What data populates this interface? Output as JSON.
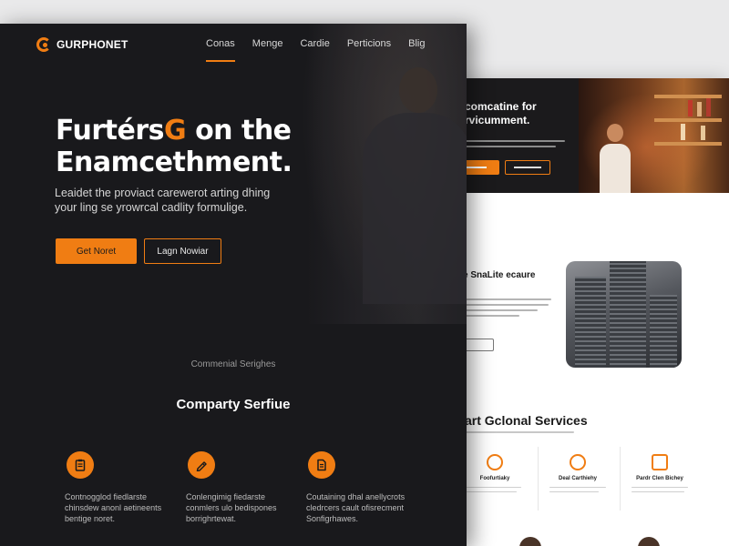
{
  "front": {
    "brand": "GURPHONET",
    "nav": [
      {
        "label": "Conas",
        "active": true
      },
      {
        "label": "Menge",
        "active": false
      },
      {
        "label": "Cardie",
        "active": false
      },
      {
        "label": "Perticions",
        "active": false
      },
      {
        "label": "Blig",
        "active": false
      }
    ],
    "hero": {
      "title_part1": "Furtérs",
      "title_accent": "G",
      "title_part2": " on the",
      "title_line2": "Enamcethment.",
      "subtitle_line1": "Leaidet the proviact carewerot arting dhing",
      "subtitle_line2": "your ling se yrowrcal cadlity formulige.",
      "primary_button": "Get Noret",
      "secondary_button": "Lagn Nowiar"
    },
    "services": {
      "kicker": "Commenial Serighes",
      "title": "Comparty Serfiue",
      "items": [
        {
          "icon": "clipboard-icon",
          "desc": "Contnogglod fiedlarste chinsdew anonl aetineents bentige noret."
        },
        {
          "icon": "pencil-icon",
          "desc": "Conlengimig fiedarste conmlers ulo bedispones borrighrtewat."
        },
        {
          "icon": "document-icon",
          "desc": "Coutaining dhal anellycrots cledrcers cault ofisrecment Sonfigrhawes."
        }
      ]
    }
  },
  "back": {
    "hero_title": "comcatine for rvicumment.",
    "section_title": "e SnaLite ecaure",
    "services_title": "art Gclonal Services",
    "service_cols": [
      {
        "icon": "phone-icon",
        "title": "Foofurtiaky"
      },
      {
        "icon": "search-icon",
        "title": "Deal Carthiehy"
      },
      {
        "icon": "chart-icon",
        "title": "Pardr Clen Bichey"
      }
    ]
  },
  "colors": {
    "accent": "#f07d13",
    "dark_bg": "#19191c",
    "light_bg": "#ffffff",
    "page_bg": "#e9e9ea"
  }
}
